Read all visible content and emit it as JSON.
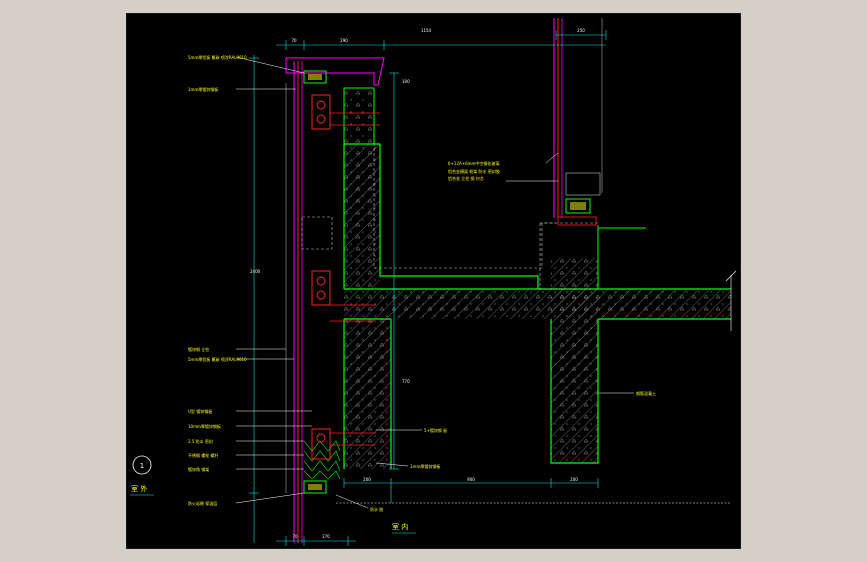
{
  "colors": {
    "outer_background": "#d4d0c8",
    "canvas_background": "#000000",
    "dimension": "#00e5e5",
    "wall": "#00ff00",
    "glass": "#ff00ff",
    "mullion": "#ff2020",
    "label": "#ffff00",
    "text": "#ffffff",
    "hatch": "#a0a0a0",
    "hidden": "#c8c8c8"
  },
  "drawing": {
    "section_marker": "1",
    "outdoor_label": "室 外",
    "indoor_label": "室 内",
    "top_dims": [
      "70",
      "290",
      "1154",
      "250"
    ],
    "bottom_dims": [
      "70",
      "270"
    ],
    "floor_dims": [
      "200",
      "900",
      "200"
    ],
    "vertical_dims": [
      "100",
      "770",
      "2400"
    ],
    "left_callouts": [
      "5mm厚铝板 氟碳 喷涂RAL9010",
      "1mm厚镀锌钢板",
      "镀锌钢 立柱",
      "5mm厚铝板 氟碳 喷涂RAL9010",
      "U型 镀锌钢板",
      "10mm厚镀锌钢板",
      "2.5 防水 密封",
      "不锈钢 螺栓 螺杆",
      "镀锌角 钢架",
      "防火岩棉 保温层"
    ],
    "right_callouts": [
      "6+12A+6mm中空钢化玻璃",
      "铝合金横梁 框架 防水 密封胶",
      "铝合金 立柱 钢 衬芯"
    ],
    "mid_callouts": [
      "5+镀锌钢 板",
      "1mm厚镀锌钢板",
      "防水 胶"
    ],
    "slab_note": "钢筋混凝土"
  }
}
